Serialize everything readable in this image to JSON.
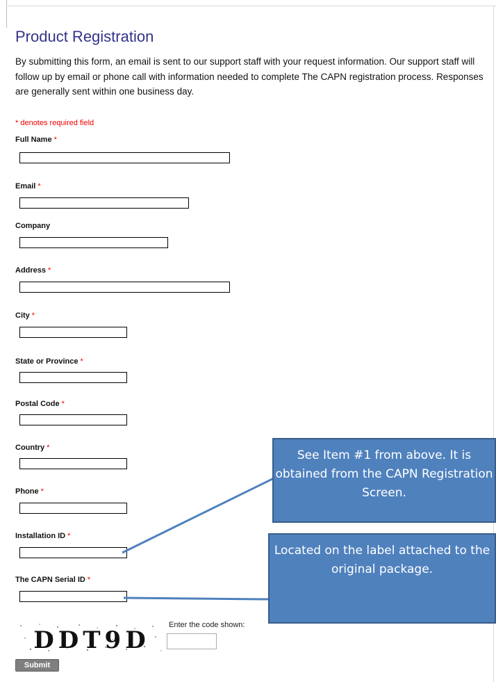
{
  "page": {
    "title": "Product Registration",
    "intro": "By submitting this form, an email is sent to our support staff with your request information. Our support staff will follow up by email or phone call with information needed to complete The CAPN registration process.  Responses are generally sent within one business day.",
    "required_note": "* denotes required field",
    "required_marker": "*"
  },
  "form": {
    "full_name_label": "Full Name",
    "email_label": "Email",
    "company_label": "Company",
    "address_label": "Address",
    "city_label": "City",
    "state_label": "State or Province",
    "postal_label": "Postal Code",
    "country_label": "Country",
    "phone_label": "Phone",
    "installation_label": "Installation ID",
    "serial_label": "The CAPN Serial ID",
    "captcha_code": "DDT9D",
    "captcha_prompt": "Enter the code shown:",
    "submit_label": "Submit"
  },
  "callouts": {
    "installation_note": "See Item #1 from above. It is obtained from the CAPN Registration Screen.",
    "serial_note": "Located on the label attached to the original package."
  },
  "colors": {
    "title": "#33338a",
    "required": "#ee0000",
    "callout_fill": "#4f81bd",
    "callout_border": "#385d8a"
  }
}
